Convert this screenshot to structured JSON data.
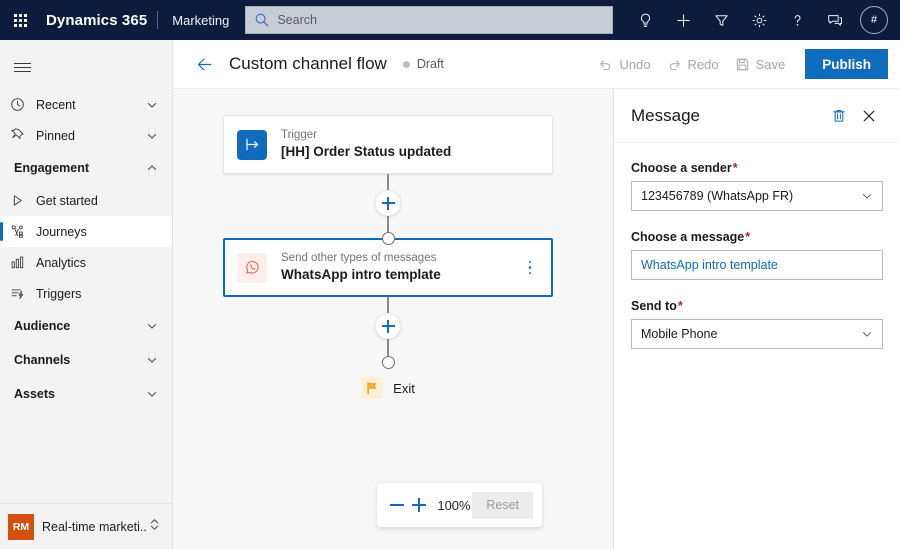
{
  "topnav": {
    "waffle_label": "app-launcher",
    "brand": "Dynamics 365",
    "app_name": "Marketing",
    "search": {
      "placeholder": "Search",
      "value": "",
      "icon": "search-icon"
    },
    "icons": [
      {
        "name": "lightbulb-icon",
        "label": "Insights"
      },
      {
        "name": "plus-icon",
        "label": "New"
      },
      {
        "name": "filter-icon",
        "label": "Filter"
      },
      {
        "name": "gear-icon",
        "label": "Settings"
      },
      {
        "name": "question-icon",
        "label": "Help"
      },
      {
        "name": "feedback-icon",
        "label": "Feedback"
      }
    ],
    "avatar": {
      "name": "avatar",
      "initials": "#"
    }
  },
  "sidebar": {
    "hamburger_label": "Show more",
    "items": [
      {
        "label": "Recent",
        "icon": "clock-icon",
        "chevron": "down",
        "type": "item",
        "selected": false
      },
      {
        "label": "Pinned",
        "icon": "pin-icon",
        "chevron": "down",
        "type": "item",
        "selected": false
      },
      {
        "label": "Engagement",
        "icon": "",
        "chevron": "up",
        "type": "group",
        "selected": false
      },
      {
        "label": "Get started",
        "icon": "play-icon",
        "chevron": "",
        "type": "sub",
        "selected": false
      },
      {
        "label": "Journeys",
        "icon": "journeys-icon",
        "chevron": "",
        "type": "sub",
        "selected": true
      },
      {
        "label": "Analytics",
        "icon": "analytics-icon",
        "chevron": "",
        "type": "sub",
        "selected": false
      },
      {
        "label": "Triggers",
        "icon": "triggers-icon",
        "chevron": "",
        "type": "sub",
        "selected": false
      },
      {
        "label": "Audience",
        "icon": "",
        "chevron": "down",
        "type": "group",
        "selected": false
      },
      {
        "label": "Channels",
        "icon": "",
        "chevron": "down",
        "type": "group",
        "selected": false
      },
      {
        "label": "Assets",
        "icon": "",
        "chevron": "down",
        "type": "group",
        "selected": false
      }
    ],
    "area_switcher": {
      "badge": "RM",
      "label": "Real-time marketi...",
      "badge_color": "#d4500f"
    }
  },
  "commandbar": {
    "back_label": "Back",
    "title": "Custom channel flow",
    "status": "Draft",
    "status_color": "#bdbdbd",
    "undo": "Undo",
    "redo": "Redo",
    "save": "Save",
    "publish": "Publish",
    "publish_color": "#0f6cbd"
  },
  "canvas": {
    "trigger_node": {
      "subtitle": "Trigger",
      "title": "[HH] Order Status updated",
      "icon": "trigger-arrow-icon",
      "icon_bg": "#0f6cbd"
    },
    "message_node": {
      "subtitle": "Send other types of messages",
      "title": "WhatsApp intro template",
      "icon": "whatsapp-icon",
      "icon_bg": "#fdeeeb",
      "icon_color": "#e8836b",
      "selected": true,
      "border_color": "#0f6cbd",
      "menu": "more-options"
    },
    "exit_node": {
      "label": "Exit",
      "icon": "flag-icon",
      "icon_bg": "#fdf0d5",
      "icon_color": "#f2a93b"
    },
    "add_step_label": "Add step",
    "zoom": {
      "minus": "−",
      "plus": "+",
      "level": "100%",
      "reset": "Reset"
    }
  },
  "panel": {
    "title": "Message",
    "delete_label": "Delete",
    "close_label": "Close",
    "fields": [
      {
        "label": "Choose a sender",
        "required": true,
        "value": "123456789 (WhatsApp FR)",
        "control": "dropdown",
        "style": "normal"
      },
      {
        "label": "Choose a message",
        "required": true,
        "value": "WhatsApp intro template",
        "control": "text",
        "style": "link"
      },
      {
        "label": "Send to",
        "required": true,
        "value": "Mobile Phone",
        "control": "dropdown",
        "style": "normal"
      }
    ]
  }
}
